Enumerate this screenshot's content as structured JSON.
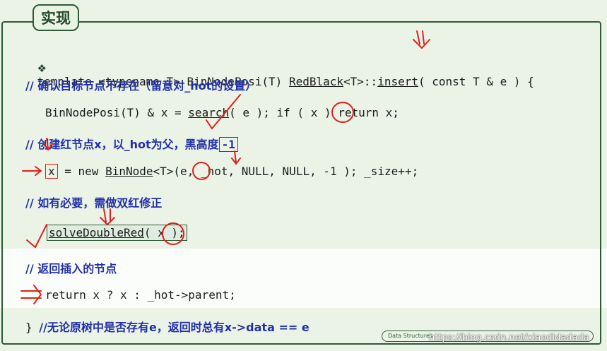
{
  "title": "实现",
  "code": {
    "bullet": "❖",
    "l1_prefix": "template <typename T> BinNodePosi(T) ",
    "l1_class": "RedBlack",
    "l1_t": "<T>::",
    "l1_method": "insert",
    "l1_suffix": "( const T & e ) {",
    "c1": "// 确认目标节点不存在（留意对_hot的设置）",
    "l2_prefix": "BinNodePosi(T) & x = ",
    "l2_search": "search",
    "l2_mid": "( e ); if ( ",
    "l2_x": "x",
    "l2_suffix": " ) return x;",
    "c2": "// 创建红节点x，以_hot为父，黑高度",
    "c2_box": "-1",
    "l3_x": "x",
    "l3_mid": " = new ",
    "l3_binnode": "BinNode",
    "l3_t": "<T>(",
    "l3_e": "e",
    "l3_suffix": ", _hot, NULL, NULL, -1 ); _size++;",
    "c3": "// 如有必要，需做双红修正",
    "l4_call": "solveDoubleRed",
    "l4_open": "( ",
    "l4_x": "x",
    "l4_close": " );",
    "c4": "// 返回插入的节点",
    "l5": "return x ? x : _hot->parent;",
    "l6_brace": "} ",
    "c6": "//无论原树中是否存有e，返回时总有x->data == e"
  },
  "footer": {
    "badge": "Data Structures",
    "watermark": "https://blog.csdn.net/xiaodidadada"
  },
  "colors": {
    "accent": "#2f5a35",
    "comment": "#2230a8",
    "annotation": "#e0201a"
  }
}
